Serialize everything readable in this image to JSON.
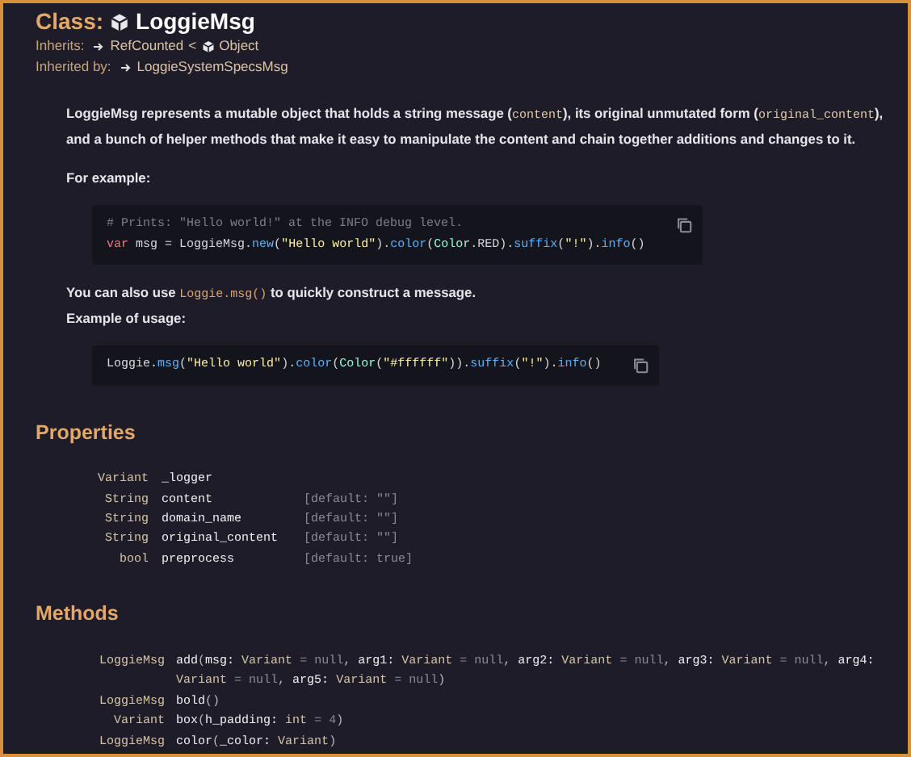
{
  "header": {
    "label": "Class:",
    "name": "LoggieMsg"
  },
  "inherits": {
    "label": "Inherits:",
    "items": [
      {
        "kind": "link",
        "text": "RefCounted"
      },
      {
        "kind": "separator",
        "text": "<"
      },
      {
        "kind": "core",
        "text": "Object"
      }
    ]
  },
  "inherited_by": {
    "label": "Inherited by:",
    "items": [
      {
        "kind": "link",
        "text": "LoggieSystemSpecsMsg"
      }
    ]
  },
  "intro": [
    {
      "kind": "paragraph",
      "lines": [
        [
          {
            "kind": "text",
            "text": "LoggieMsg represents a mutable object that holds a string message ("
          },
          {
            "kind": "code",
            "text": "content"
          },
          {
            "kind": "text",
            "text": "), its original unmutated form ("
          },
          {
            "kind": "code",
            "text": "original_content"
          },
          {
            "kind": "text",
            "text": "), and a bunch of helper methods that make it easy to manipulate the content and chain together additions and changes to it."
          }
        ]
      ]
    },
    {
      "kind": "paragraph",
      "lines": [
        [
          {
            "kind": "text",
            "text": "For example:"
          }
        ]
      ]
    },
    {
      "kind": "code_block",
      "lines": [
        [
          {
            "kind": "comment",
            "text": "# Prints: \"Hello world!\" at the INFO debug level."
          }
        ],
        [
          {
            "kind": "keyword",
            "text": "var"
          },
          {
            "kind": "plain",
            "text": " msg = LoggieMsg."
          },
          {
            "kind": "function",
            "text": "new"
          },
          {
            "kind": "plain",
            "text": "("
          },
          {
            "kind": "string",
            "text": "\"Hello world\""
          },
          {
            "kind": "plain",
            "text": ")."
          },
          {
            "kind": "function",
            "text": "color"
          },
          {
            "kind": "plain",
            "text": "("
          },
          {
            "kind": "type",
            "text": "Color"
          },
          {
            "kind": "plain",
            "text": ".RED)."
          },
          {
            "kind": "function",
            "text": "suffix"
          },
          {
            "kind": "plain",
            "text": "("
          },
          {
            "kind": "string",
            "text": "\"!\""
          },
          {
            "kind": "plain",
            "text": ")."
          },
          {
            "kind": "function",
            "text": "info"
          },
          {
            "kind": "plain",
            "text": "()"
          }
        ]
      ]
    },
    {
      "kind": "paragraph",
      "lines": [
        [
          {
            "kind": "text",
            "text": "You can also use "
          },
          {
            "kind": "link",
            "text": "Loggie.msg()"
          },
          {
            "kind": "text",
            "text": " to quickly construct a message."
          }
        ],
        [
          {
            "kind": "text",
            "text": "Example of usage:"
          }
        ]
      ]
    },
    {
      "kind": "code_block",
      "lines": [
        [
          {
            "kind": "plain",
            "text": "Loggie."
          },
          {
            "kind": "function",
            "text": "msg"
          },
          {
            "kind": "plain",
            "text": "("
          },
          {
            "kind": "string",
            "text": "\"Hello world\""
          },
          {
            "kind": "plain",
            "text": ")."
          },
          {
            "kind": "function",
            "text": "color"
          },
          {
            "kind": "plain",
            "text": "("
          },
          {
            "kind": "type",
            "text": "Color"
          },
          {
            "kind": "plain",
            "text": "("
          },
          {
            "kind": "string",
            "text": "\"#ffffff\""
          },
          {
            "kind": "plain",
            "text": "))."
          },
          {
            "kind": "function",
            "text": "suffix"
          },
          {
            "kind": "plain",
            "text": "("
          },
          {
            "kind": "string",
            "text": "\"!\""
          },
          {
            "kind": "plain",
            "text": ")."
          },
          {
            "kind": "function",
            "text": "info"
          },
          {
            "kind": "plain",
            "text": "()"
          }
        ]
      ]
    }
  ],
  "properties": {
    "title": "Properties",
    "rows": [
      {
        "type": "Variant",
        "name": "_logger"
      },
      {
        "type": "String",
        "name": "content",
        "default": "[default: \"\"]"
      },
      {
        "type": "String",
        "name": "domain_name",
        "default": "[default: \"\"]"
      },
      {
        "type": "String",
        "name": "original_content",
        "default": "[default: \"\"]"
      },
      {
        "type": "bool",
        "name": "preprocess",
        "default": "[default: true]"
      }
    ]
  },
  "methods": {
    "title": "Methods",
    "rows": [
      {
        "type": "LoggieMsg",
        "signature": [
          {
            "kind": "name",
            "text": "add"
          },
          {
            "kind": "punct",
            "text": "("
          },
          {
            "kind": "name",
            "text": "msg: "
          },
          {
            "kind": "type",
            "text": "Variant"
          },
          {
            "kind": "default",
            "text": " = null"
          },
          {
            "kind": "punct",
            "text": ", "
          },
          {
            "kind": "name",
            "text": "arg1: "
          },
          {
            "kind": "type",
            "text": "Variant"
          },
          {
            "kind": "default",
            "text": " = null"
          },
          {
            "kind": "punct",
            "text": ", "
          },
          {
            "kind": "name",
            "text": "arg2: "
          },
          {
            "kind": "type",
            "text": "Variant"
          },
          {
            "kind": "default",
            "text": " = null"
          },
          {
            "kind": "punct",
            "text": ", "
          },
          {
            "kind": "name",
            "text": "arg3: "
          },
          {
            "kind": "type",
            "text": "Variant"
          },
          {
            "kind": "default",
            "text": " = null"
          },
          {
            "kind": "punct",
            "text": ", "
          },
          {
            "kind": "name",
            "text": "arg4: "
          },
          {
            "kind": "type",
            "text": "Variant"
          },
          {
            "kind": "default",
            "text": " = null"
          },
          {
            "kind": "punct",
            "text": ", "
          },
          {
            "kind": "name",
            "text": "arg5: "
          },
          {
            "kind": "type",
            "text": "Variant"
          },
          {
            "kind": "default",
            "text": " = null"
          },
          {
            "kind": "punct",
            "text": ")"
          }
        ]
      },
      {
        "type": "LoggieMsg",
        "signature": [
          {
            "kind": "name",
            "text": "bold"
          },
          {
            "kind": "punct",
            "text": "()"
          }
        ]
      },
      {
        "type": "Variant",
        "signature": [
          {
            "kind": "name",
            "text": "box"
          },
          {
            "kind": "punct",
            "text": "("
          },
          {
            "kind": "name",
            "text": "h_padding: "
          },
          {
            "kind": "type",
            "text": "int"
          },
          {
            "kind": "default",
            "text": " = 4"
          },
          {
            "kind": "punct",
            "text": ")"
          }
        ]
      },
      {
        "type": "LoggieMsg",
        "signature": [
          {
            "kind": "name",
            "text": "color"
          },
          {
            "kind": "punct",
            "text": "("
          },
          {
            "kind": "name",
            "text": "_color: "
          },
          {
            "kind": "type",
            "text": "Variant"
          },
          {
            "kind": "punct",
            "text": ")"
          }
        ]
      }
    ]
  }
}
